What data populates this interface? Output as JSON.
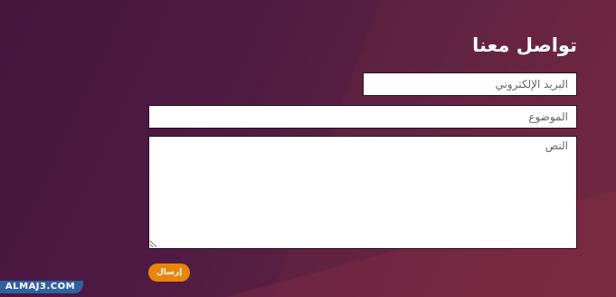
{
  "contact_form": {
    "title": "تواصل معنا",
    "email_placeholder": "البريد الإلكتروني",
    "subject_placeholder": "الموضوع",
    "message_placeholder": "النص",
    "send_label": "إرسال"
  },
  "watermark": {
    "text": "ALMAJ3.COM"
  },
  "colors": {
    "background": "#4e1a43",
    "accent": "#e8860c",
    "field_background": "#ffffff"
  }
}
